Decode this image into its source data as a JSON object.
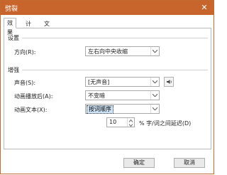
{
  "window": {
    "title": "劈裂",
    "close_symbol": "✕",
    "accent": "#c8652c"
  },
  "tabs": [
    {
      "label": "效果"
    },
    {
      "label": "计时"
    },
    {
      "label": "文本动画"
    }
  ],
  "settings": {
    "section_title": "设置",
    "direction_label": "方向(R):",
    "direction_value": "左右向中央收缩"
  },
  "enhancements": {
    "section_title": "增强",
    "sound_label": "声音(S):",
    "sound_value": "[无声音]",
    "after_anim_label": "动画播放后(A):",
    "after_anim_value": "不变暗",
    "anim_text_label": "动画文本(X):",
    "anim_text_value": "按词顺序",
    "delay_value": "10",
    "delay_suffix": "% 字/词之间延迟(D)"
  },
  "footer": {
    "ok_label": "确定",
    "cancel_label": "取消"
  }
}
